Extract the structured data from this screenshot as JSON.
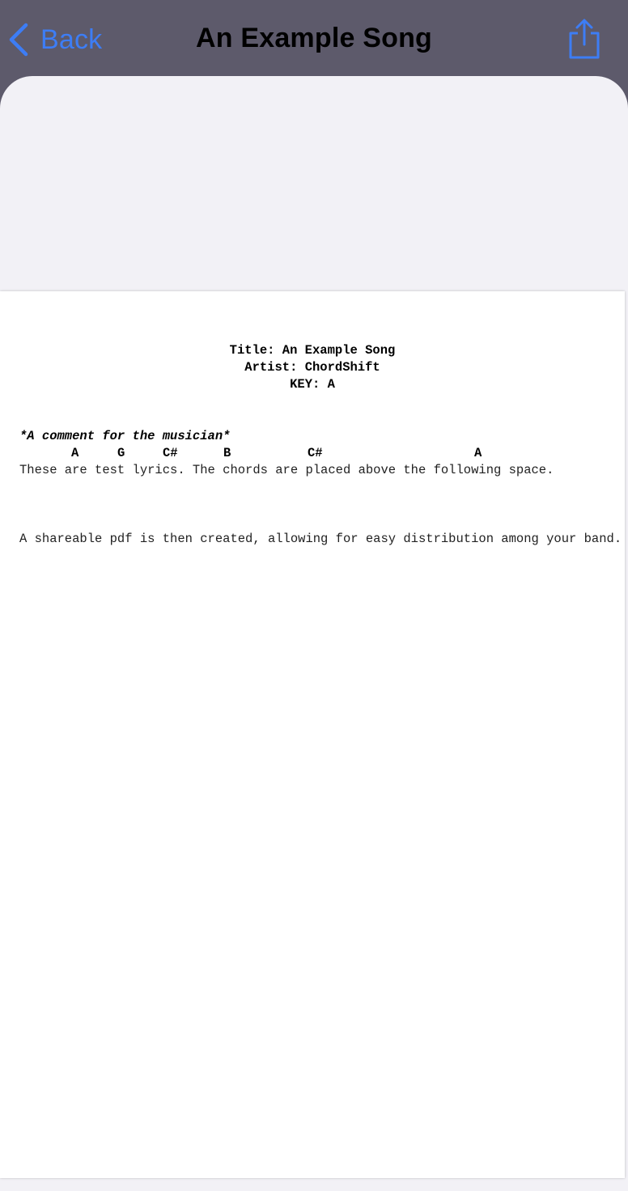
{
  "navbar": {
    "back_label": "Back",
    "title": "An Example Song",
    "accent_color": "#3d7df5",
    "background_color": "#5d5a6b",
    "share_icon": "share-icon"
  },
  "document": {
    "title_line": "Title: An Example Song",
    "artist_line": "Artist: ChordShift",
    "key_line": "KEY: A",
    "comment": "*A comment for the musician*",
    "chords": [
      "A",
      "G",
      "C#",
      "B",
      "C#",
      "A"
    ],
    "lyric_line_1": "These are test lyrics. The chords are placed above the following space.",
    "lyric_line_2": "A shareable pdf is then created, allowing for easy distribution among your band."
  }
}
